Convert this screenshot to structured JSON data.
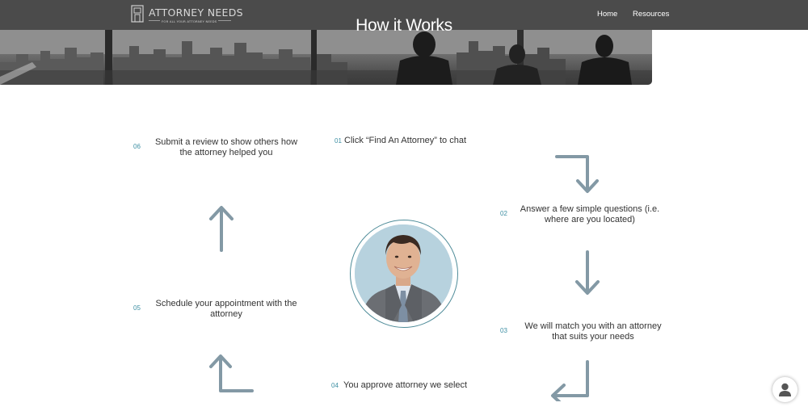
{
  "header": {
    "logo_title": "ATTORNEY NEEDS",
    "logo_tagline": "FOR ALL YOUR ATTORNEY NEEDS",
    "nav": {
      "home_label": "Home",
      "resources_label": "Resources"
    }
  },
  "hero": {
    "title": "How it Works"
  },
  "steps": [
    {
      "number": "01",
      "text": "Click “Find An Attorney” to chat"
    },
    {
      "number": "02",
      "text_line1": "Answer a few simple questions (i.e.",
      "text_line2": "where are you located)"
    },
    {
      "number": "03",
      "text_line1": "We will match you with an attorney",
      "text_line2": "that suits your needs"
    },
    {
      "number": "04",
      "text": "You approve attorney we select"
    },
    {
      "number": "05",
      "text_line1": "Schedule your appointment with the",
      "text_line2": "attorney"
    },
    {
      "number": "06",
      "text_line1": "Submit a review to show others how",
      "text_line2": "the attorney helped you"
    }
  ],
  "icons": {
    "arrows_color": "#8399a5",
    "accent_color": "#3d8fa3",
    "chat_icon": "user-chat-icon"
  }
}
